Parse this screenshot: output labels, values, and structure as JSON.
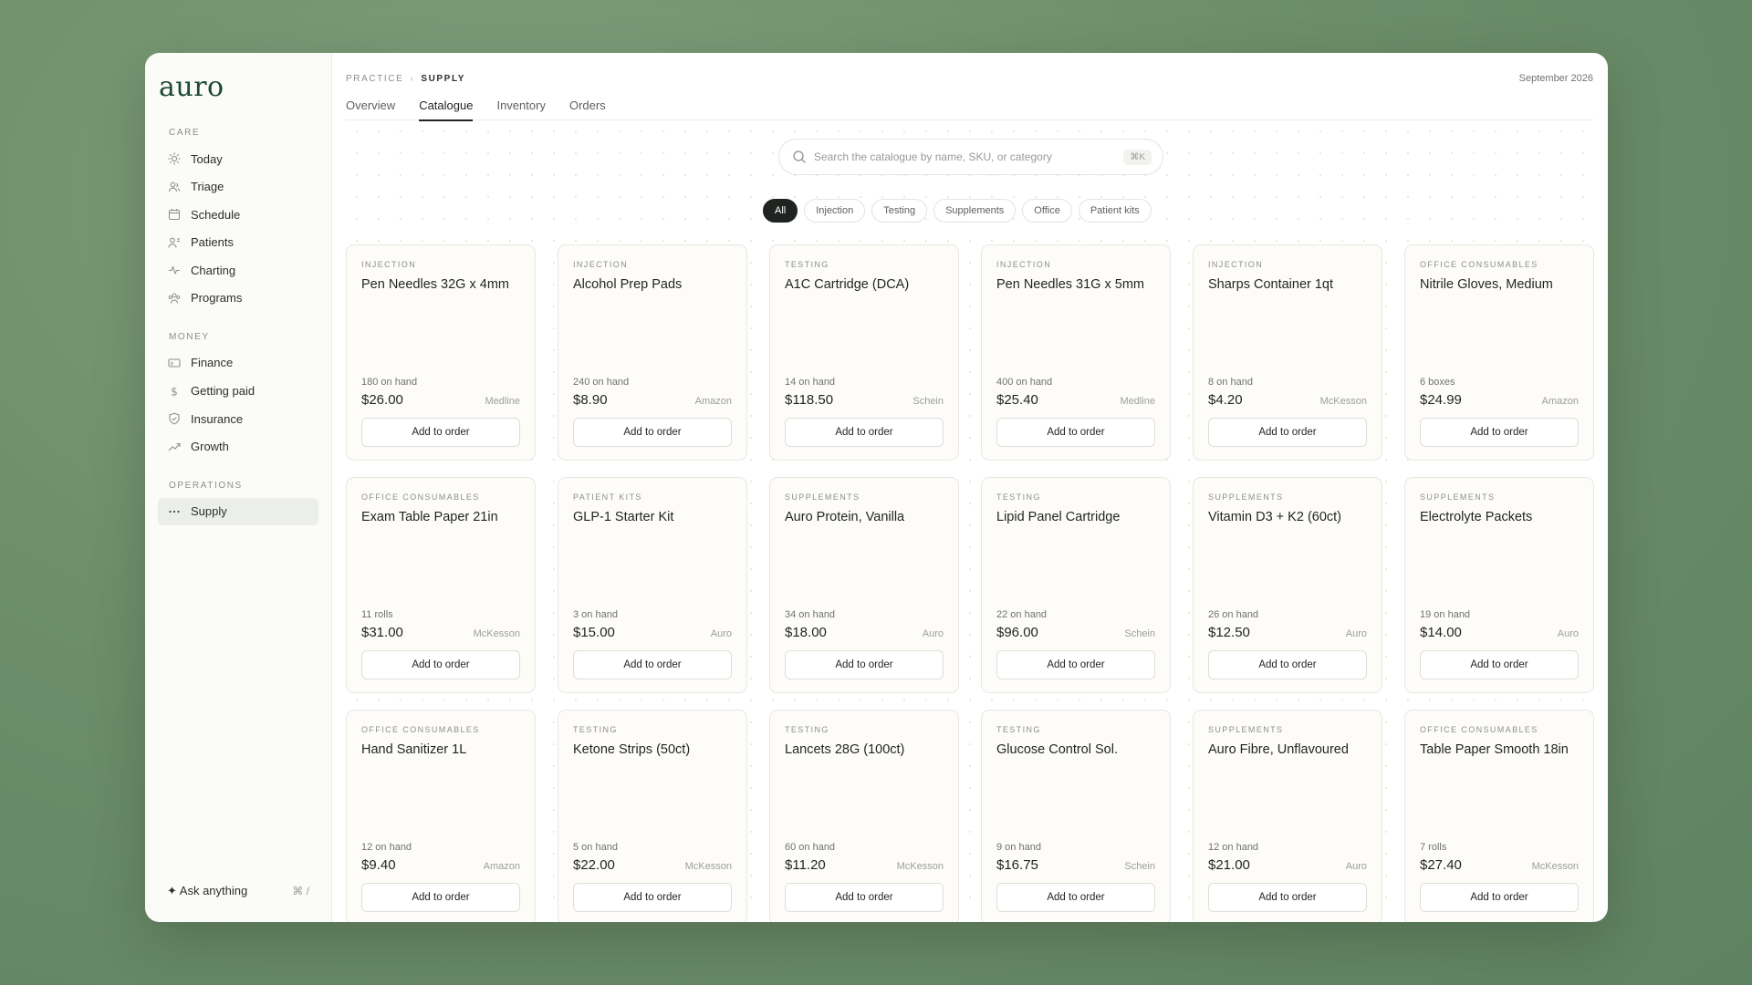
{
  "brand": "auro",
  "sidebar": {
    "sections": [
      {
        "label": "CARE",
        "items": [
          {
            "label": "Today",
            "icon": "sun-icon"
          },
          {
            "label": "Triage",
            "icon": "users-icon"
          },
          {
            "label": "Schedule",
            "icon": "calendar-icon"
          },
          {
            "label": "Patients",
            "icon": "patient-icon"
          },
          {
            "label": "Charting",
            "icon": "activity-icon"
          },
          {
            "label": "Programs",
            "icon": "group-icon"
          }
        ]
      },
      {
        "label": "MONEY",
        "items": [
          {
            "label": "Finance",
            "icon": "card-icon"
          },
          {
            "label": "Getting paid",
            "icon": "dollar-icon"
          },
          {
            "label": "Insurance",
            "icon": "shield-icon"
          },
          {
            "label": "Growth",
            "icon": "trend-icon"
          }
        ]
      },
      {
        "label": "OPERATIONS",
        "items": [
          {
            "label": "Supply",
            "icon": "dots-icon",
            "active": true
          }
        ]
      }
    ],
    "ask": {
      "label": "Ask anything",
      "shortcut": "⌘ /"
    }
  },
  "header": {
    "breadcrumb": [
      "PRACTICE",
      "SUPPLY"
    ],
    "date": "September 2026",
    "tabs": [
      {
        "label": "Overview"
      },
      {
        "label": "Catalogue",
        "active": true
      },
      {
        "label": "Inventory"
      },
      {
        "label": "Orders"
      }
    ]
  },
  "search": {
    "placeholder": "Search the catalogue by name, SKU, or category",
    "shortcut": "⌘K"
  },
  "filters": [
    {
      "label": "All",
      "active": true
    },
    {
      "label": "Injection"
    },
    {
      "label": "Testing"
    },
    {
      "label": "Supplements"
    },
    {
      "label": "Office"
    },
    {
      "label": "Patient kits"
    }
  ],
  "button_label": "Add to order",
  "products": [
    {
      "category": "INJECTION",
      "name": "Pen Needles 32G x 4mm",
      "stock": "180 on hand",
      "price": "$26.00",
      "vendor": "Medline"
    },
    {
      "category": "INJECTION",
      "name": "Alcohol Prep Pads",
      "stock": "240 on hand",
      "price": "$8.90",
      "vendor": "Amazon"
    },
    {
      "category": "TESTING",
      "name": "A1C Cartridge (DCA)",
      "stock": "14 on hand",
      "price": "$118.50",
      "vendor": "Schein"
    },
    {
      "category": "INJECTION",
      "name": "Pen Needles 31G x 5mm",
      "stock": "400 on hand",
      "price": "$25.40",
      "vendor": "Medline"
    },
    {
      "category": "INJECTION",
      "name": "Sharps Container 1qt",
      "stock": "8 on hand",
      "price": "$4.20",
      "vendor": "McKesson"
    },
    {
      "category": "OFFICE CONSUMABLES",
      "name": "Nitrile Gloves, Medium",
      "stock": "6 boxes",
      "price": "$24.99",
      "vendor": "Amazon"
    },
    {
      "category": "OFFICE CONSUMABLES",
      "name": "Exam Table Paper 21in",
      "stock": "11 rolls",
      "price": "$31.00",
      "vendor": "McKesson"
    },
    {
      "category": "PATIENT KITS",
      "name": "GLP-1 Starter Kit",
      "stock": "3 on hand",
      "price": "$15.00",
      "vendor": "Auro"
    },
    {
      "category": "SUPPLEMENTS",
      "name": "Auro Protein, Vanilla",
      "stock": "34 on hand",
      "price": "$18.00",
      "vendor": "Auro"
    },
    {
      "category": "TESTING",
      "name": "Lipid Panel Cartridge",
      "stock": "22 on hand",
      "price": "$96.00",
      "vendor": "Schein"
    },
    {
      "category": "SUPPLEMENTS",
      "name": "Vitamin D3 + K2 (60ct)",
      "stock": "26 on hand",
      "price": "$12.50",
      "vendor": "Auro"
    },
    {
      "category": "SUPPLEMENTS",
      "name": "Electrolyte Packets",
      "stock": "19 on hand",
      "price": "$14.00",
      "vendor": "Auro"
    },
    {
      "category": "OFFICE CONSUMABLES",
      "name": "Hand Sanitizer 1L",
      "stock": "12 on hand",
      "price": "$9.40",
      "vendor": "Amazon"
    },
    {
      "category": "TESTING",
      "name": "Ketone Strips (50ct)",
      "stock": "5 on hand",
      "price": "$22.00",
      "vendor": "McKesson"
    },
    {
      "category": "TESTING",
      "name": "Lancets 28G (100ct)",
      "stock": "60 on hand",
      "price": "$11.20",
      "vendor": "McKesson"
    },
    {
      "category": "TESTING",
      "name": "Glucose Control Sol.",
      "stock": "9 on hand",
      "price": "$16.75",
      "vendor": "Schein"
    },
    {
      "category": "SUPPLEMENTS",
      "name": "Auro Fibre, Unflavoured",
      "stock": "12 on hand",
      "price": "$21.00",
      "vendor": "Auro"
    },
    {
      "category": "OFFICE CONSUMABLES",
      "name": "Table Paper Smooth 18in",
      "stock": "7 rolls",
      "price": "$27.40",
      "vendor": "McKesson"
    }
  ]
}
